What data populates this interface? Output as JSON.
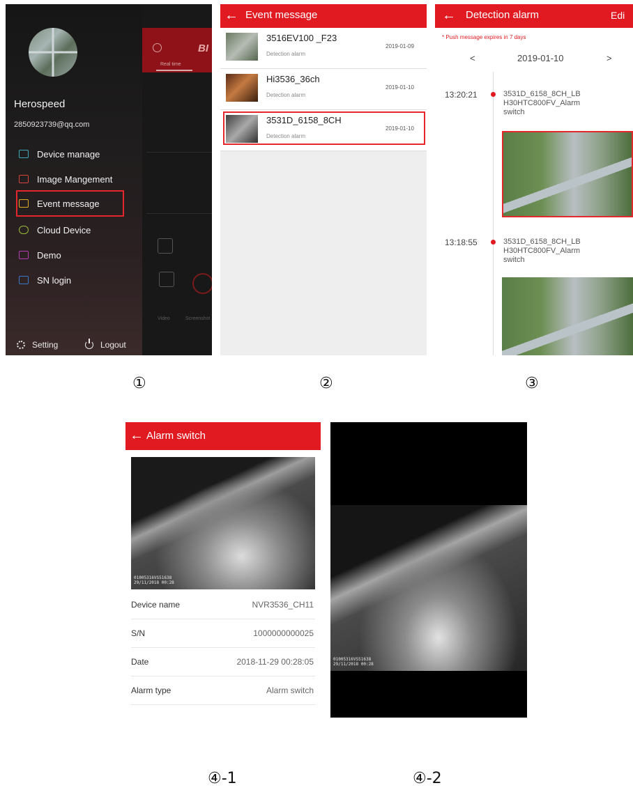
{
  "panel1": {
    "user_name": "Herospeed",
    "email": "2850923739@qq.com",
    "menu": [
      {
        "label": "Device manage",
        "icon": "camera-icon",
        "color": "#3fa9b5"
      },
      {
        "label": "Image Mangement",
        "icon": "image-icon",
        "color": "#d8453a"
      },
      {
        "label": "Event message",
        "icon": "envelope-icon",
        "color": "#e0a92a"
      },
      {
        "label": "Cloud Device",
        "icon": "cloud-icon",
        "color": "#9cbc3a"
      },
      {
        "label": "Demo",
        "icon": "play-monitor-icon",
        "color": "#b33fb0"
      },
      {
        "label": "SN login",
        "icon": "sn-icon",
        "color": "#3a7cc9"
      }
    ],
    "setting_label": "Setting",
    "logout_label": "Logout",
    "bg_pane": {
      "brand": "BI",
      "tab": "Real time",
      "video": "Video",
      "screenshot": "Screenshot"
    }
  },
  "panel2": {
    "title": "Event message",
    "events": [
      {
        "name": "3516EV100 _F23",
        "type": "Detection alarm",
        "date": "2019-01-09"
      },
      {
        "name": "Hi3536_36ch",
        "type": "Detection alarm",
        "date": "2019-01-10"
      },
      {
        "name": "3531D_6158_8CH",
        "type": "Detection alarm",
        "date": "2019-01-10"
      }
    ]
  },
  "panel3": {
    "title": "Detection alarm",
    "edit_label": "Edi",
    "notice": "* Push message expires in 7 days",
    "prev": "<",
    "date": "2019-01-10",
    "next": ">",
    "entries": [
      {
        "time": "13:20:21",
        "line1": "3531D_6158_8CH_LB",
        "line2": "H30HTC800FV_Alarm",
        "line3": "switch"
      },
      {
        "time": "13:18:55",
        "line1": "3531D_6158_8CH_LB",
        "line2": "H30HTC800FV_Alarm",
        "line3": "switch"
      }
    ]
  },
  "panel4": {
    "title": "Alarm switch",
    "stamp1": "01005316VS51638",
    "stamp2": "29/11/2018 00:28",
    "rows": [
      {
        "key": "Device name",
        "value": "NVR3536_CH11"
      },
      {
        "key": "S/N",
        "value": "1000000000025"
      },
      {
        "key": "Date",
        "value": "2018-11-29 00:28:05"
      },
      {
        "key": "Alarm type",
        "value": "Alarm switch"
      }
    ]
  },
  "captions": {
    "c1": "①",
    "c2": "②",
    "c3": "③",
    "c4": "④-1",
    "c5": "④-2"
  },
  "colors": {
    "accent": "#e11a22",
    "highlight": "#e3272a"
  }
}
